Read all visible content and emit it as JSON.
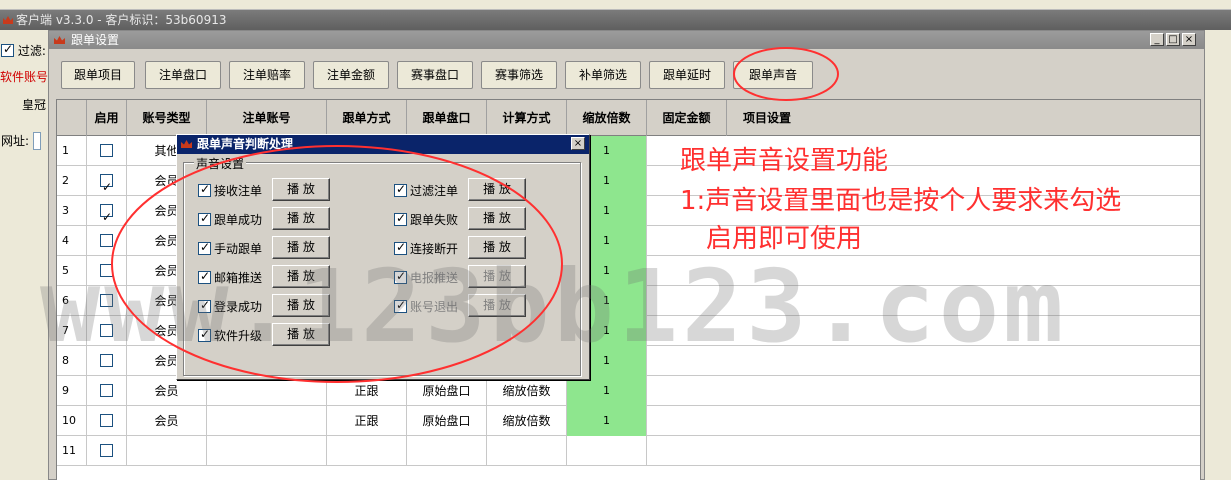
{
  "app": {
    "title": "客户端  v3.3.0 - 客户标识：53b60913",
    "filter_label": "过滤:",
    "software_account": "软件账号",
    "crown": "皇冠",
    "url_label": "网址:"
  },
  "dialog": {
    "title": "跟单设置",
    "min": "_",
    "max": "□",
    "close": "×"
  },
  "tabs": [
    "跟单项目",
    "注单盘口",
    "注单赔率",
    "注单金额",
    "赛事盘口",
    "赛事筛选",
    "补单筛选",
    "跟单延时",
    "跟单声音"
  ],
  "grid": {
    "columns": [
      "",
      "启用",
      "账号类型",
      "注单账号",
      "跟单方式",
      "跟单盘口",
      "计算方式",
      "缩放倍数",
      "固定金额",
      "项目设置"
    ],
    "rows": [
      {
        "n": "1",
        "on": false,
        "type": "其他",
        "mode": "",
        "pan": "",
        "calc": "",
        "scale": "1"
      },
      {
        "n": "2",
        "on": true,
        "type": "会员",
        "mode": "",
        "pan": "",
        "calc": "",
        "scale": "1"
      },
      {
        "n": "3",
        "on": true,
        "type": "会员",
        "mode": "",
        "pan": "",
        "calc": "",
        "scale": "1"
      },
      {
        "n": "4",
        "on": false,
        "type": "会员",
        "mode": "",
        "pan": "",
        "calc": "",
        "scale": "1"
      },
      {
        "n": "5",
        "on": false,
        "type": "会员",
        "mode": "",
        "pan": "",
        "calc": "",
        "scale": "1"
      },
      {
        "n": "6",
        "on": false,
        "type": "会员",
        "mode": "",
        "pan": "",
        "calc": "",
        "scale": "1"
      },
      {
        "n": "7",
        "on": false,
        "type": "会员",
        "mode": "",
        "pan": "",
        "calc": "",
        "scale": "1"
      },
      {
        "n": "8",
        "on": false,
        "type": "会员",
        "mode": "",
        "pan": "",
        "calc": "",
        "scale": "1"
      },
      {
        "n": "9",
        "on": false,
        "type": "会员",
        "mode": "正跟",
        "pan": "原始盘口",
        "calc": "缩放倍数",
        "scale": "1"
      },
      {
        "n": "10",
        "on": false,
        "type": "会员",
        "mode": "正跟",
        "pan": "原始盘口",
        "calc": "缩放倍数",
        "scale": "1"
      },
      {
        "n": "11",
        "on": false,
        "type": "",
        "mode": "",
        "pan": "",
        "calc": "",
        "scale": ""
      }
    ]
  },
  "popup": {
    "title": "跟单声音判断处理",
    "close": "×",
    "group_label": "声音设置",
    "play_label": "播 放",
    "options": [
      {
        "label": "接收注单",
        "checked": true,
        "enabled": true
      },
      {
        "label": "过滤注单",
        "checked": true,
        "enabled": true
      },
      {
        "label": "跟单成功",
        "checked": true,
        "enabled": true
      },
      {
        "label": "跟单失败",
        "checked": true,
        "enabled": true
      },
      {
        "label": "手动跟单",
        "checked": true,
        "enabled": true
      },
      {
        "label": "连接断开",
        "checked": true,
        "enabled": true
      },
      {
        "label": "邮箱推送",
        "checked": true,
        "enabled": true
      },
      {
        "label": "电报推送",
        "checked": true,
        "enabled": false
      },
      {
        "label": "登录成功",
        "checked": true,
        "enabled": true
      },
      {
        "label": "账号退出",
        "checked": true,
        "enabled": false
      },
      {
        "label": "软件升级",
        "checked": true,
        "enabled": true
      }
    ]
  },
  "annotation": {
    "line1": "跟单声音设置功能",
    "line2": "1:声音设置里面也是按个人要求来勾选",
    "line3": "启用即可使用"
  },
  "watermark": "www.123bb123.com",
  "colors": {
    "title_active": "#0a246a",
    "scale_cell": "#8ee68e",
    "annotation": "#ff3030"
  }
}
